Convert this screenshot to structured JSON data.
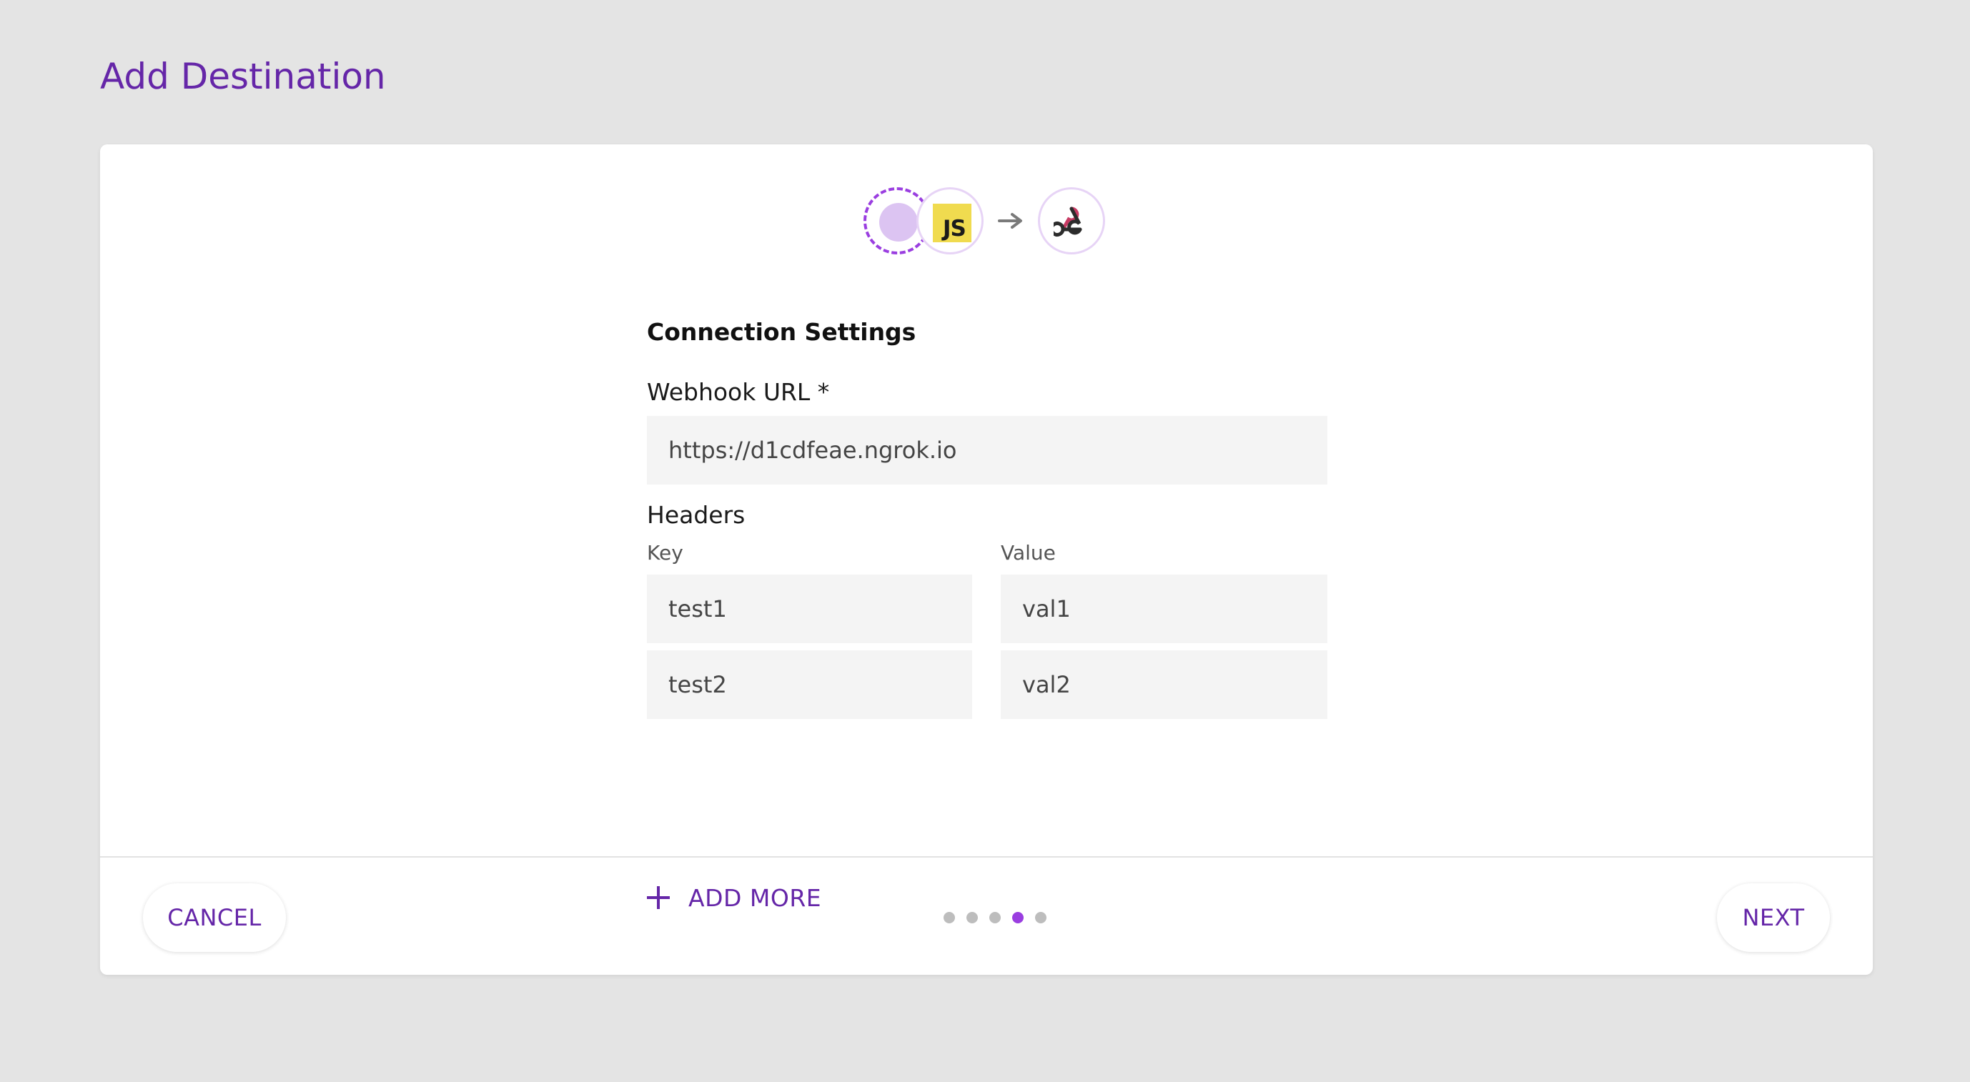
{
  "page": {
    "title": "Add Destination"
  },
  "flow": {
    "source_icon": "source-placeholder-icon",
    "sdk_icon": "javascript-icon",
    "sdk_badge_text": "JS",
    "arrow_icon": "arrow-right-icon",
    "destination_icon": "webhook-icon"
  },
  "form": {
    "section_title": "Connection Settings",
    "webhook_url_label": "Webhook URL *",
    "webhook_url_value": "https://d1cdfeae.ngrok.io",
    "headers_label": "Headers",
    "key_label": "Key",
    "value_label": "Value",
    "headers": [
      {
        "key": "test1",
        "value": "val1"
      },
      {
        "key": "test2",
        "value": "val2"
      }
    ],
    "add_more_label": "ADD MORE"
  },
  "footer": {
    "cancel_label": "CANCEL",
    "next_label": "NEXT",
    "steps_total": 5,
    "current_step": 4
  },
  "colors": {
    "accent": "#6526a8",
    "accent_light": "#9a3ee0",
    "background": "#e4e4e4",
    "input_bg": "#f4f4f4",
    "js_yellow": "#f0db4f",
    "webhook_red": "#c73a63"
  }
}
